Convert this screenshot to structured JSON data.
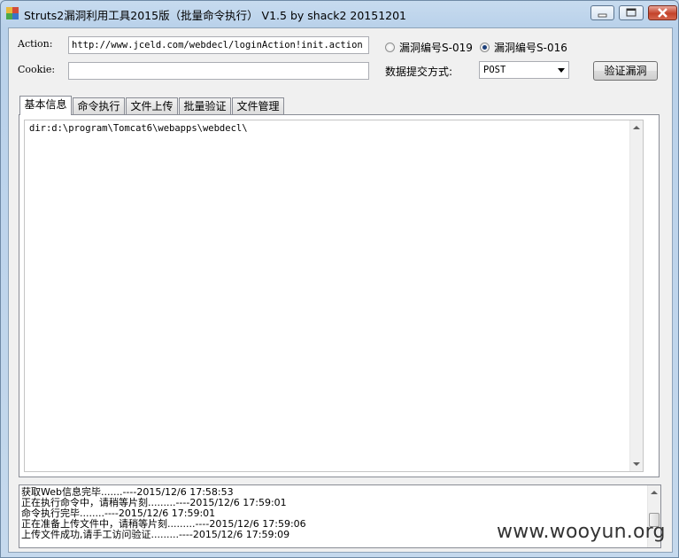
{
  "window": {
    "title": "Struts2漏洞利用工具2015版（批量命令执行） V1.5 by shack2  20151201"
  },
  "form": {
    "action_label": "Action:",
    "action_value": "http://www.jceld.com/webdecl/loginAction!init.action",
    "cookie_label": "Cookie:",
    "cookie_value": "",
    "radio_s019": "漏洞编号S-019",
    "radio_s016": "漏洞编号S-016",
    "selected_vuln": "S-016",
    "method_label": "数据提交方式:",
    "method_value": "POST",
    "verify_button": "验证漏洞"
  },
  "tabs": [
    {
      "label": "基本信息",
      "active": true
    },
    {
      "label": "命令执行",
      "active": false
    },
    {
      "label": "文件上传",
      "active": false
    },
    {
      "label": "批量验证",
      "active": false
    },
    {
      "label": "文件管理",
      "active": false
    }
  ],
  "main": {
    "output": "dir:d:\\program\\Tomcat6\\webapps\\webdecl\\"
  },
  "log": {
    "lines": [
      "获取Web信息完毕.......----2015/12/6 17:58:53",
      "正在执行命令中，请稍等片刻.........----2015/12/6 17:59:01",
      "命令执行完毕........----2015/12/6 17:59:01",
      "正在准备上传文件中，请稍等片刻.........----2015/12/6 17:59:06",
      "上传文件成功,请手工访问验证.........----2015/12/6 17:59:09"
    ]
  },
  "watermark": "www.wooyun.org"
}
